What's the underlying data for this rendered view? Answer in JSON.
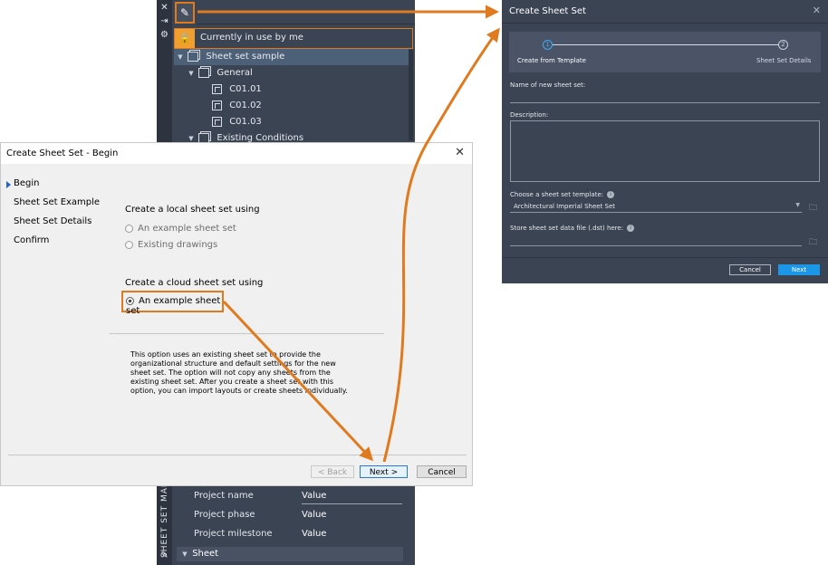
{
  "ssm_palette": {
    "in_use_text": "Currently in use by me",
    "tree": [
      {
        "label": "Sheet set sample",
        "kind": "set",
        "level": 0,
        "expanded": true,
        "selected": true
      },
      {
        "label": "General",
        "kind": "subset",
        "level": 1,
        "expanded": true
      },
      {
        "label": "C01.01",
        "kind": "sheet",
        "level": 2
      },
      {
        "label": "C01.02",
        "kind": "sheet",
        "level": 2
      },
      {
        "label": "C01.03",
        "kind": "sheet",
        "level": 2
      },
      {
        "label": "Existing Conditions",
        "kind": "subset",
        "level": 1,
        "expanded": true
      }
    ],
    "vertical_title": "SHEET SET MANA",
    "properties": [
      {
        "name": "Project name",
        "value": "Value"
      },
      {
        "name": "Project phase",
        "value": "Value"
      },
      {
        "name": "Project milestone",
        "value": "Value"
      }
    ],
    "sheet_section": "Sheet"
  },
  "begin_dialog": {
    "title": "Create Sheet Set - Begin",
    "nav": [
      "Begin",
      "Sheet Set Example",
      "Sheet Set Details",
      "Confirm"
    ],
    "active_nav": "Begin",
    "local_group_title": "Create a local sheet set using",
    "local_options": [
      "An example sheet set",
      "Existing drawings"
    ],
    "cloud_group_title": "Create a cloud sheet set using",
    "cloud_option": "An example sheet set",
    "description": "This option uses an existing sheet set to provide the organizational structure and default settings for the new sheet set.  The option will not copy any sheets from the existing sheet set.  After you create a sheet set with this option, you can import layouts or create sheets individually.",
    "buttons": {
      "back": "< Back",
      "next": "Next >",
      "cancel": "Cancel"
    }
  },
  "create_dialog": {
    "title": "Create Sheet Set",
    "steps": [
      {
        "number": "1",
        "label": "Create from Template",
        "active": true
      },
      {
        "number": "2",
        "label": "Sheet Set Details",
        "active": false
      }
    ],
    "name_label": "Name of new sheet set:",
    "description_label": "Description:",
    "template_label": "Choose a sheet set template:",
    "template_value": "Architectural Imperial Sheet Set",
    "store_label": "Store sheet set data file (.dst) here:",
    "buttons": {
      "cancel": "Cancel",
      "next": "Next"
    }
  },
  "colors": {
    "accent_orange": "#e07a1f",
    "dark_panel": "#3b4453",
    "primary_blue": "#1c97e8"
  }
}
